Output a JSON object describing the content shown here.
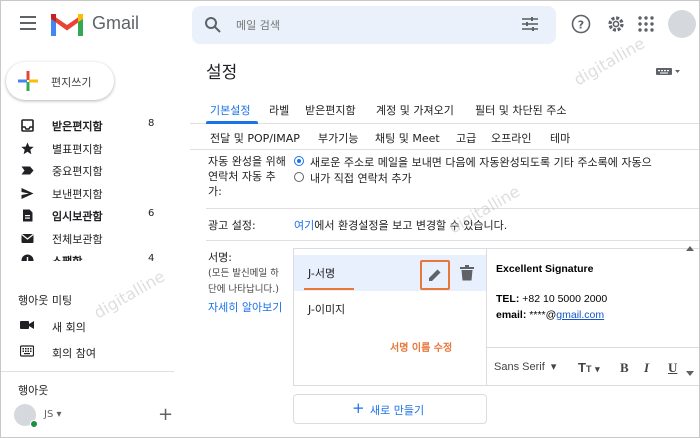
{
  "header": {
    "brand": "Gmail",
    "search_placeholder": "메일 검색"
  },
  "sidebar": {
    "compose_label": "편지쓰기",
    "items": [
      {
        "label": "받은편지함",
        "count": "8",
        "bold": true,
        "icon": "inbox-icon"
      },
      {
        "label": "별표편지함",
        "count": "",
        "bold": false,
        "icon": "star-icon"
      },
      {
        "label": "중요편지함",
        "count": "",
        "bold": false,
        "icon": "important-icon"
      },
      {
        "label": "보낸편지함",
        "count": "",
        "bold": false,
        "icon": "send-icon"
      },
      {
        "label": "임시보관함",
        "count": "6",
        "bold": true,
        "icon": "draft-icon"
      },
      {
        "label": "전체보관함",
        "count": "",
        "bold": false,
        "icon": "mail-icon"
      },
      {
        "label": "스팸함",
        "count": "4",
        "bold": true,
        "icon": "spam-icon"
      }
    ],
    "meet_title": "행아웃 미팅",
    "meet_items": [
      {
        "label": "새 회의",
        "icon": "video-icon"
      },
      {
        "label": "회의 참여",
        "icon": "keyboard-icon"
      }
    ],
    "hangouts_title": "행아웃",
    "user_initials": "JS"
  },
  "settings": {
    "title": "설정",
    "tabs_row1": [
      "기본설정",
      "라벨",
      "받은편지함",
      "계정 및 가져오기",
      "필터 및 차단된 주소"
    ],
    "tabs_row2": [
      "전달 및 POP/IMAP",
      "부가기능",
      "채팅 및 Meet",
      "고급",
      "오프라인",
      "테마"
    ],
    "autocomplete_label": "자동 완성을 위해 연락처 자동 추가:",
    "autocomplete_options": [
      {
        "label": "새로운 주소로 메일을 보내면 다음에 자동완성되도록 기타 주소록에 자동으",
        "checked": true
      },
      {
        "label": "내가 직접 연락처 추가",
        "checked": false
      }
    ],
    "ads_label": "광고 설정:",
    "ads_link": "여기",
    "ads_text": "에서 환경설정을 보고 변경할 수 있습니다.",
    "signature_label": "서명:",
    "signature_desc": "(모든 발신메일 하단에 나타납니다.)",
    "signature_desc_line1": "(모든 발신메일 하",
    "signature_desc_line2": "단에 나타납니다.)",
    "learn_more": "자세히 알아보기",
    "signatures": [
      {
        "name": "J-서명",
        "selected": true
      },
      {
        "name": "J-이미지",
        "selected": false
      }
    ],
    "annotation": "서명 이름 수정",
    "editor": {
      "title_line": "Excellent Signature",
      "tel_label": "TEL:",
      "tel_value": "+82 10 5000 2000",
      "email_label": "email:",
      "email_prefix": "****@",
      "email_link": "gmail.com",
      "font": "Sans Serif"
    },
    "new_button": "새로 만들기"
  },
  "watermark": "digitalline",
  "colors": {
    "accent": "#1a73e8",
    "annotation": "#e8773a",
    "search_bg": "#eaf1fb"
  }
}
